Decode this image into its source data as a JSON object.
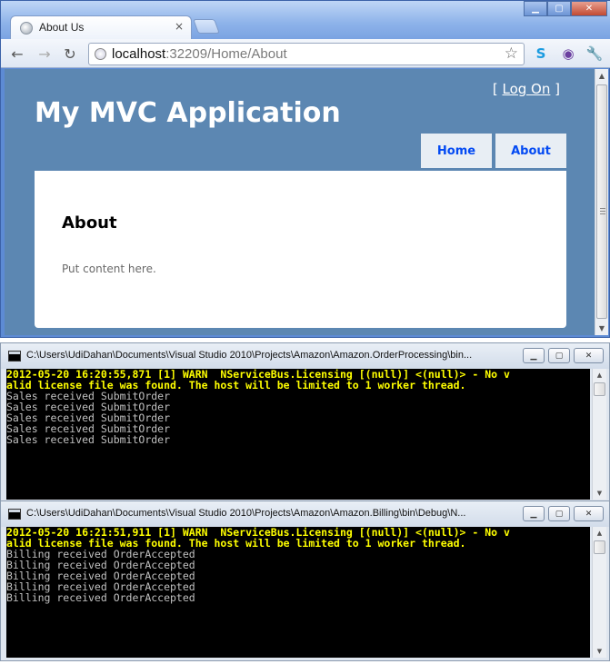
{
  "browser": {
    "tab_title": "About Us",
    "tab_close": "×",
    "url_host": "localhost",
    "url_path": ":32209/Home/About",
    "window_buttons": {
      "minimize": "▁",
      "maximize": "▢",
      "close": "✕"
    },
    "nav": {
      "back": "←",
      "forward": "→",
      "reload": "↻"
    },
    "bookmark_star": "☆",
    "extensions": {
      "skype": "S",
      "eye": "◉",
      "wrench": "🔧"
    }
  },
  "site": {
    "logon_open": "[ ",
    "logon_link": "Log On",
    "logon_close": " ]",
    "title": "My MVC Application",
    "menu": [
      {
        "label": "Home"
      },
      {
        "label": "About"
      }
    ],
    "heading": "About",
    "content": "Put content here."
  },
  "consoles": [
    {
      "title": "C:\\Users\\UdiDahan\\Documents\\Visual Studio 2010\\Projects\\Amazon\\Amazon.OrderProcessing\\bin...",
      "buttons": {
        "minimize": "▁",
        "maximize": "▢",
        "close": "✕"
      },
      "warn_lines": [
        "2012-05-20 16:20:55,871 [1] WARN  NServiceBus.Licensing [(null)] <(null)> - No v",
        "alid license file was found. The host will be limited to 1 worker thread."
      ],
      "lines": [
        "Sales received SubmitOrder",
        "Sales received SubmitOrder",
        "Sales received SubmitOrder",
        "Sales received SubmitOrder",
        "Sales received SubmitOrder"
      ]
    },
    {
      "title": "C:\\Users\\UdiDahan\\Documents\\Visual Studio 2010\\Projects\\Amazon\\Amazon.Billing\\bin\\Debug\\N...",
      "buttons": {
        "minimize": "▁",
        "maximize": "▢",
        "close": "✕"
      },
      "warn_lines": [
        "2012-05-20 16:21:51,911 [1] WARN  NServiceBus.Licensing [(null)] <(null)> - No v",
        "alid license file was found. The host will be limited to 1 worker thread."
      ],
      "lines": [
        "Billing received OrderAccepted",
        "Billing received OrderAccepted",
        "Billing received OrderAccepted",
        "Billing received OrderAccepted",
        "Billing received OrderAccepted"
      ]
    }
  ],
  "colors": {
    "page_background": "#5c87b2",
    "menu_link": "#034af3",
    "console_warn": "#ffff00",
    "console_text": "#c0c0c0"
  }
}
